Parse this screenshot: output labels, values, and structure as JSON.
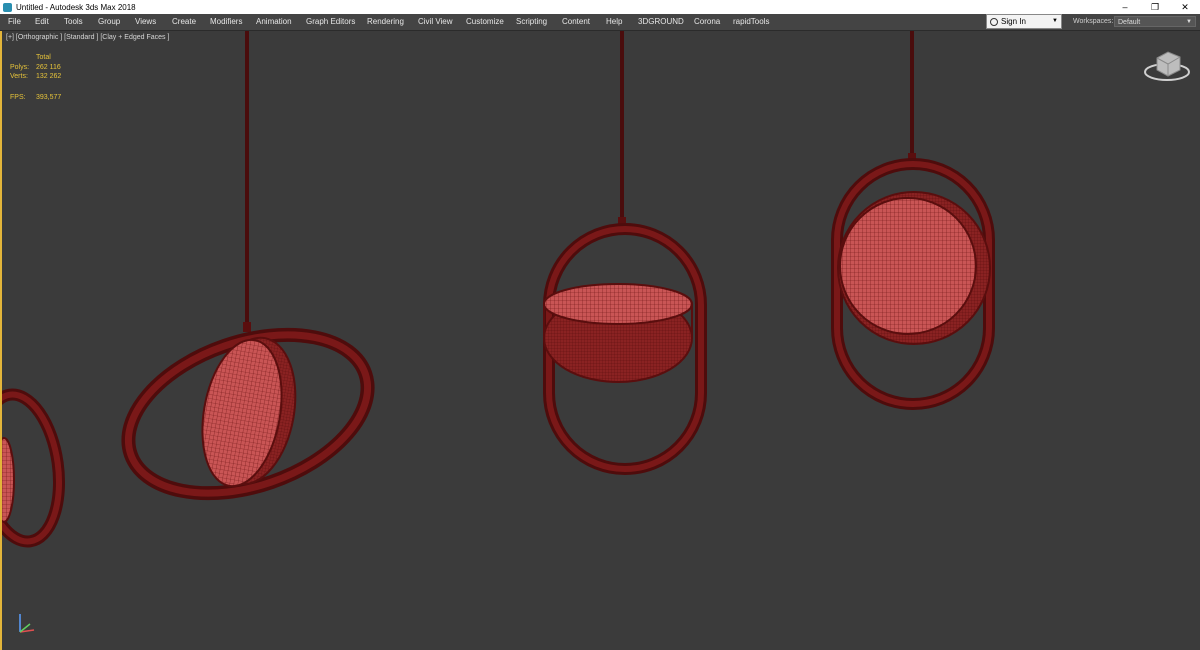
{
  "window": {
    "title": "Untitled - Autodesk 3ds Max 2018",
    "minimize": "–",
    "maximize": "❐",
    "close": "✕"
  },
  "menu": [
    "File",
    "Edit",
    "Tools",
    "Group",
    "Views",
    "Create",
    "Modifiers",
    "Animation",
    "Graph Editors",
    "Rendering",
    "Civil View",
    "Customize",
    "Scripting",
    "Content",
    "Help",
    "3DGROUND",
    "Corona",
    "rapidTools"
  ],
  "signin": {
    "label": "Sign In"
  },
  "workspaces": {
    "label": "Workspaces:",
    "value": "Default"
  },
  "viewport": {
    "label": "[+] [Orthographic ] [Standard ] [Clay + Edged Faces ]",
    "stats": {
      "total_header": "Total",
      "polys_label": "Polys:",
      "polys_value": "262 116",
      "verts_label": "Verts:",
      "verts_value": "132 262",
      "fps_label": "FPS:",
      "fps_value": "393,577"
    }
  },
  "colors": {
    "accent": "#e3b53a",
    "stats_text": "#e6c33a",
    "mesh": "#6e1414",
    "disc": "#c95555",
    "viewport_bg": "#3b3b3b"
  },
  "icons": {
    "app": "3ds-max-app-icon",
    "viewcube": "viewcube-icon",
    "axis": "axis-tripod-icon",
    "user": "user-icon"
  }
}
